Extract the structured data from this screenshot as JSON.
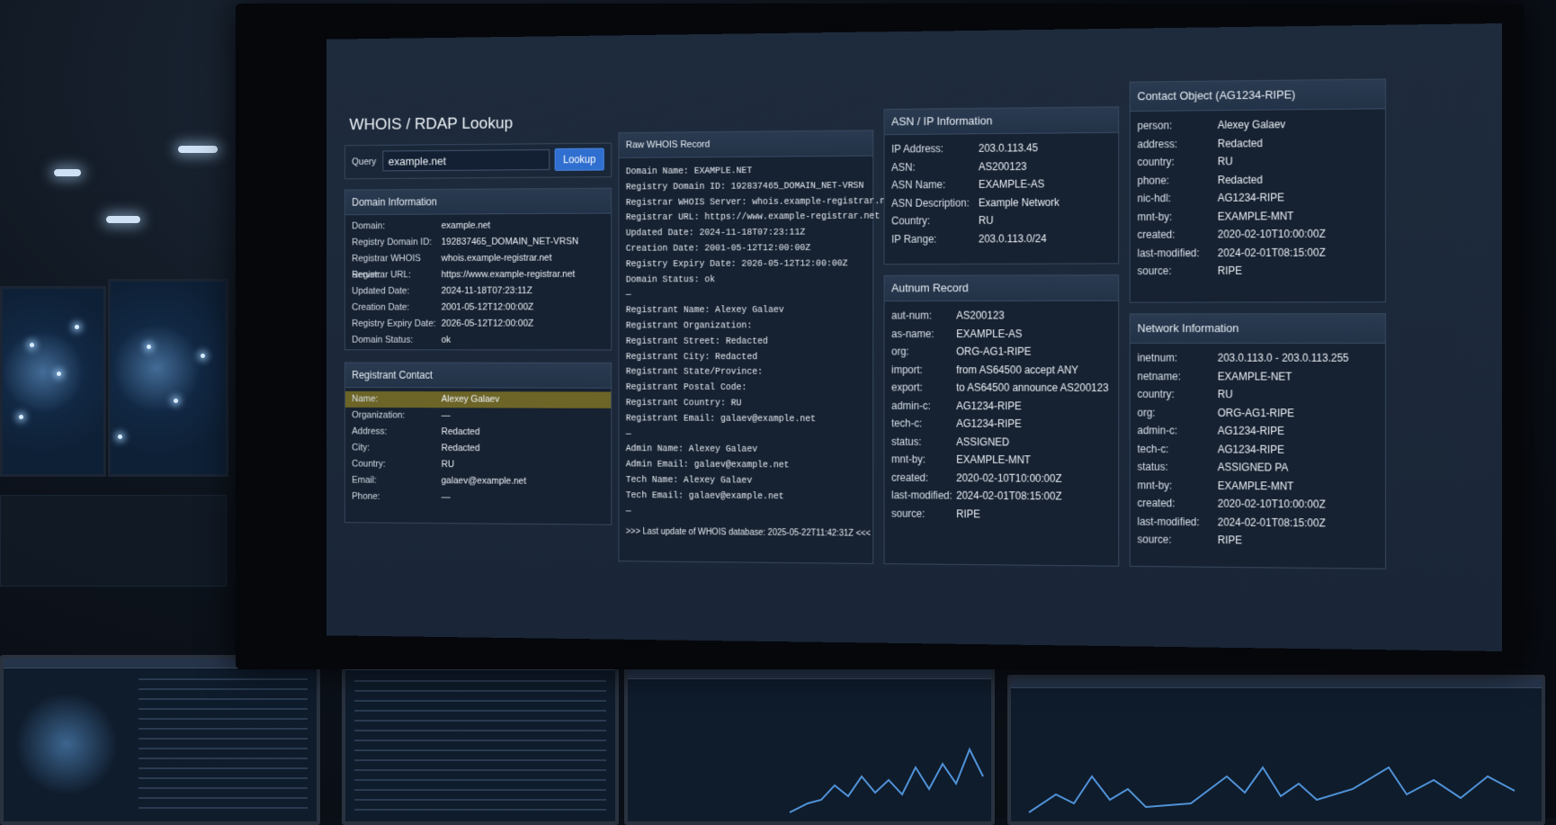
{
  "app": {
    "title": "WHOIS / RDAP Lookup"
  },
  "query": {
    "label": "Query",
    "value": "example.net",
    "button": "Lookup"
  },
  "domain_info": {
    "title": "Domain Information",
    "rows": [
      {
        "key": "Domain:",
        "value": "example.net"
      },
      {
        "key": "Registry Domain ID:",
        "value": "192837465_DOMAIN_NET-VRSN"
      },
      {
        "key": "Registrar WHOIS Server:",
        "value": "whois.example-registrar.net"
      },
      {
        "key": "Registrar URL:",
        "value": "https://www.example-registrar.net"
      },
      {
        "key": "Updated Date:",
        "value": "2024-11-18T07:23:11Z"
      },
      {
        "key": "Creation Date:",
        "value": "2001-05-12T12:00:00Z"
      },
      {
        "key": "Registry Expiry Date:",
        "value": "2026-05-12T12:00:00Z"
      },
      {
        "key": "Domain Status:",
        "value": "ok"
      }
    ]
  },
  "registrant_contact": {
    "title": "Registrant Contact",
    "rows": [
      {
        "key": "Name:",
        "value": "Alexey Galaev"
      },
      {
        "key": "Organization:",
        "value": "—"
      },
      {
        "key": "Address:",
        "value": "Redacted"
      },
      {
        "key": "City:",
        "value": "Redacted"
      },
      {
        "key": "Country:",
        "value": "RU"
      },
      {
        "key": "Email:",
        "value": "galaev@example.net"
      },
      {
        "key": "Phone:",
        "value": "—"
      }
    ]
  },
  "raw_whois": {
    "title": "Raw WHOIS Record",
    "lines": [
      "Domain Name: EXAMPLE.NET",
      "Registry Domain ID: 192837465_DOMAIN_NET-VRSN",
      "Registrar WHOIS Server: whois.example-registrar.net",
      "Registrar URL: https://www.example-registrar.net",
      "Updated Date: 2024-11-18T07:23:11Z",
      "Creation Date: 2001-05-12T12:00:00Z",
      "Registry Expiry Date: 2026-05-12T12:00:00Z",
      "Domain Status: ok",
      "—",
      "Registrant Name: Alexey Galaev",
      "Registrant Organization:",
      "Registrant Street: Redacted",
      "Registrant City: Redacted",
      "Registrant State/Province:",
      "Registrant Postal Code:",
      "Registrant Country: RU",
      "Registrant Email: galaev@example.net",
      "—",
      "Admin Name: Alexey Galaev",
      "Admin Email: galaev@example.net",
      "Tech Name: Alexey Galaev",
      "Tech Email: galaev@example.net",
      "—"
    ],
    "footer": ">>> Last update of WHOIS database: 2025-05-22T11:42:31Z <<<"
  },
  "asn_ip": {
    "title": "ASN / IP Information",
    "rows": [
      {
        "key": "IP Address:",
        "value": "203.0.113.45"
      },
      {
        "key": "ASN:",
        "value": "AS200123"
      },
      {
        "key": "ASN Name:",
        "value": "EXAMPLE-AS"
      },
      {
        "key": "ASN Description:",
        "value": "Example Network"
      },
      {
        "key": "Country:",
        "value": "RU"
      },
      {
        "key": "IP Range:",
        "value": "203.0.113.0/24"
      }
    ]
  },
  "autnum": {
    "title": "Autnum Record",
    "rows": [
      {
        "key": "aut-num:",
        "value": "AS200123"
      },
      {
        "key": "as-name:",
        "value": "EXAMPLE-AS"
      },
      {
        "key": "org:",
        "value": "ORG-AG1-RIPE"
      },
      {
        "key": "import:",
        "value": "from AS64500 accept ANY"
      },
      {
        "key": "export:",
        "value": "to AS64500 announce AS200123"
      },
      {
        "key": "admin-c:",
        "value": "AG1234-RIPE"
      },
      {
        "key": "tech-c:",
        "value": "AG1234-RIPE"
      },
      {
        "key": "status:",
        "value": "ASSIGNED"
      },
      {
        "key": "mnt-by:",
        "value": "EXAMPLE-MNT"
      },
      {
        "key": "created:",
        "value": "2020-02-10T10:00:00Z"
      },
      {
        "key": "last-modified:",
        "value": "2024-02-01T08:15:00Z"
      },
      {
        "key": "source:",
        "value": "RIPE"
      }
    ]
  },
  "contact_object": {
    "title": "Contact Object (AG1234-RIPE)",
    "rows": [
      {
        "key": "person:",
        "value": "Alexey Galaev"
      },
      {
        "key": "address:",
        "value": "Redacted"
      },
      {
        "key": "country:",
        "value": "RU"
      },
      {
        "key": "phone:",
        "value": "Redacted"
      },
      {
        "key": "nic-hdl:",
        "value": "AG1234-RIPE"
      },
      {
        "key": "mnt-by:",
        "value": "EXAMPLE-MNT"
      },
      {
        "key": "created:",
        "value": "2020-02-10T10:00:00Z"
      },
      {
        "key": "last-modified:",
        "value": "2024-02-01T08:15:00Z"
      },
      {
        "key": "source:",
        "value": "RIPE"
      }
    ]
  },
  "network_info": {
    "title": "Network Information",
    "rows": [
      {
        "key": "inetnum:",
        "value": "203.0.113.0 - 203.0.113.255"
      },
      {
        "key": "netname:",
        "value": "EXAMPLE-NET"
      },
      {
        "key": "country:",
        "value": "RU"
      },
      {
        "key": "org:",
        "value": "ORG-AG1-RIPE"
      },
      {
        "key": "admin-c:",
        "value": "AG1234-RIPE"
      },
      {
        "key": "tech-c:",
        "value": "AG1234-RIPE"
      },
      {
        "key": "status:",
        "value": "ASSIGNED PA"
      },
      {
        "key": "mnt-by:",
        "value": "EXAMPLE-MNT"
      },
      {
        "key": "created:",
        "value": "2020-02-10T10:00:00Z"
      },
      {
        "key": "last-modified:",
        "value": "2024-02-01T08:15:00Z"
      },
      {
        "key": "source:",
        "value": "RIPE"
      }
    ]
  },
  "colors": {
    "panel_bg": "#162131",
    "highlight": "#6d6527",
    "accent_button": "#2f6fd0"
  }
}
